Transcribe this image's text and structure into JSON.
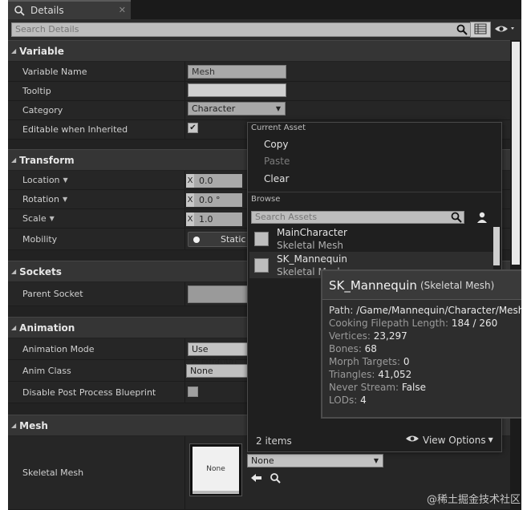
{
  "tab": {
    "title": "Details",
    "close": "✕"
  },
  "search": {
    "placeholder": "Search Details"
  },
  "categories": {
    "variable": "Variable",
    "transform": "Transform",
    "sockets": "Sockets",
    "animation": "Animation",
    "mesh": "Mesh"
  },
  "variable": {
    "name_label": "Variable Name",
    "name_value": "Mesh",
    "tooltip_label": "Tooltip",
    "tooltip_value": "",
    "category_label": "Category",
    "category_value": "Character",
    "editable_label": "Editable when Inherited",
    "editable_checked": true
  },
  "transform": {
    "location_label": "Location",
    "location_x": "0.0",
    "rotation_label": "Rotation",
    "rotation_x": "0.0 °",
    "scale_label": "Scale",
    "scale_x": "1.0",
    "mobility_label": "Mobility",
    "mobility_value": "Static",
    "axis_x": "X"
  },
  "sockets": {
    "parent_label": "Parent Socket"
  },
  "animation": {
    "mode_label": "Animation Mode",
    "mode_value": "Use Animation",
    "class_label": "Anim Class",
    "class_value": "None",
    "disable_label": "Disable Post Process Blueprint"
  },
  "mesh": {
    "skeletal_label": "Skeletal Mesh",
    "thumb_text": "None",
    "combo_value": "None"
  },
  "popup": {
    "current_asset_header": "Current Asset",
    "copy": "Copy",
    "paste": "Paste",
    "clear": "Clear",
    "browse_header": "Browse",
    "search_placeholder": "Search Assets",
    "assets": [
      {
        "name": "MainCharacter",
        "type": "Skeletal Mesh"
      },
      {
        "name": "SK_Mannequin",
        "type": "Skeletal Mesh"
      }
    ],
    "count": "2 items",
    "view_options": "View Options"
  },
  "tooltip": {
    "name": "SK_Mannequin",
    "type": "(Skeletal Mesh)",
    "lines": [
      {
        "k": "Path: ",
        "v": "/Game/Mannequin/Character/Mesh"
      },
      {
        "k": "Cooking Filepath Length: ",
        "v": "184 / 260"
      },
      {
        "k": "Vertices: ",
        "v": "23,297"
      },
      {
        "k": "Bones: ",
        "v": "68"
      },
      {
        "k": "Morph Targets: ",
        "v": "0"
      },
      {
        "k": "Triangles: ",
        "v": "41,052"
      },
      {
        "k": "Never Stream: ",
        "v": "False"
      },
      {
        "k": "LODs: ",
        "v": "4"
      }
    ]
  },
  "watermark": "@稀土掘金技术社区",
  "colors": {
    "panel": "#222222",
    "category": "#353535",
    "popup": "#1f1f1f"
  }
}
